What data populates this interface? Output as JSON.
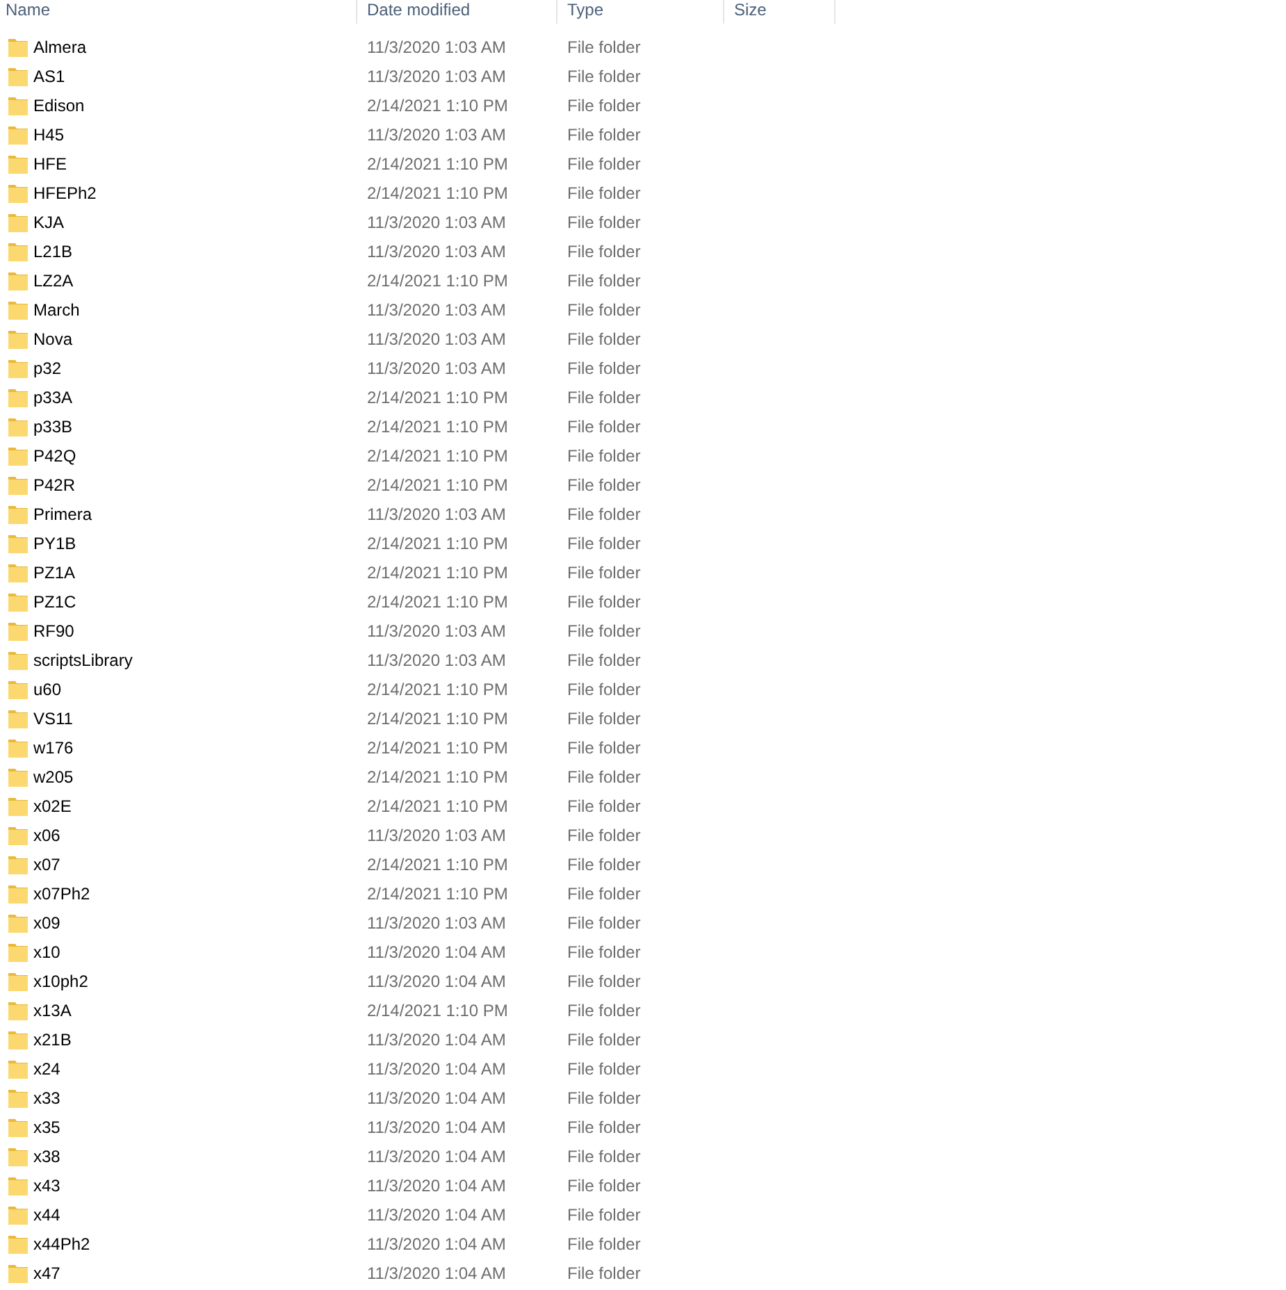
{
  "columns": [
    "Name",
    "Date modified",
    "Type",
    "Size"
  ],
  "rows": [
    {
      "name": "Almera",
      "date_modified": "11/3/2020 1:03 AM",
      "type": "File folder"
    },
    {
      "name": "AS1",
      "date_modified": "11/3/2020 1:03 AM",
      "type": "File folder"
    },
    {
      "name": "Edison",
      "date_modified": "2/14/2021 1:10 PM",
      "type": "File folder"
    },
    {
      "name": "H45",
      "date_modified": "11/3/2020 1:03 AM",
      "type": "File folder"
    },
    {
      "name": "HFE",
      "date_modified": "2/14/2021 1:10 PM",
      "type": "File folder"
    },
    {
      "name": "HFEPh2",
      "date_modified": "2/14/2021 1:10 PM",
      "type": "File folder"
    },
    {
      "name": "KJA",
      "date_modified": "11/3/2020 1:03 AM",
      "type": "File folder"
    },
    {
      "name": "L21B",
      "date_modified": "11/3/2020 1:03 AM",
      "type": "File folder"
    },
    {
      "name": "LZ2A",
      "date_modified": "2/14/2021 1:10 PM",
      "type": "File folder"
    },
    {
      "name": "March",
      "date_modified": "11/3/2020 1:03 AM",
      "type": "File folder"
    },
    {
      "name": "Nova",
      "date_modified": "11/3/2020 1:03 AM",
      "type": "File folder"
    },
    {
      "name": "p32",
      "date_modified": "11/3/2020 1:03 AM",
      "type": "File folder"
    },
    {
      "name": "p33A",
      "date_modified": "2/14/2021 1:10 PM",
      "type": "File folder"
    },
    {
      "name": "p33B",
      "date_modified": "2/14/2021 1:10 PM",
      "type": "File folder"
    },
    {
      "name": "P42Q",
      "date_modified": "2/14/2021 1:10 PM",
      "type": "File folder"
    },
    {
      "name": "P42R",
      "date_modified": "2/14/2021 1:10 PM",
      "type": "File folder"
    },
    {
      "name": "Primera",
      "date_modified": "11/3/2020 1:03 AM",
      "type": "File folder"
    },
    {
      "name": "PY1B",
      "date_modified": "2/14/2021 1:10 PM",
      "type": "File folder"
    },
    {
      "name": "PZ1A",
      "date_modified": "2/14/2021 1:10 PM",
      "type": "File folder"
    },
    {
      "name": "PZ1C",
      "date_modified": "2/14/2021 1:10 PM",
      "type": "File folder"
    },
    {
      "name": "RF90",
      "date_modified": "11/3/2020 1:03 AM",
      "type": "File folder"
    },
    {
      "name": "scriptsLibrary",
      "date_modified": "11/3/2020 1:03 AM",
      "type": "File folder"
    },
    {
      "name": "u60",
      "date_modified": "2/14/2021 1:10 PM",
      "type": "File folder"
    },
    {
      "name": "VS11",
      "date_modified": "2/14/2021 1:10 PM",
      "type": "File folder"
    },
    {
      "name": "w176",
      "date_modified": "2/14/2021 1:10 PM",
      "type": "File folder"
    },
    {
      "name": "w205",
      "date_modified": "2/14/2021 1:10 PM",
      "type": "File folder"
    },
    {
      "name": "x02E",
      "date_modified": "2/14/2021 1:10 PM",
      "type": "File folder"
    },
    {
      "name": "x06",
      "date_modified": "11/3/2020 1:03 AM",
      "type": "File folder"
    },
    {
      "name": "x07",
      "date_modified": "2/14/2021 1:10 PM",
      "type": "File folder"
    },
    {
      "name": "x07Ph2",
      "date_modified": "2/14/2021 1:10 PM",
      "type": "File folder"
    },
    {
      "name": "x09",
      "date_modified": "11/3/2020 1:03 AM",
      "type": "File folder"
    },
    {
      "name": "x10",
      "date_modified": "11/3/2020 1:04 AM",
      "type": "File folder"
    },
    {
      "name": "x10ph2",
      "date_modified": "11/3/2020 1:04 AM",
      "type": "File folder"
    },
    {
      "name": "x13A",
      "date_modified": "2/14/2021 1:10 PM",
      "type": "File folder"
    },
    {
      "name": "x21B",
      "date_modified": "11/3/2020 1:04 AM",
      "type": "File folder"
    },
    {
      "name": "x24",
      "date_modified": "11/3/2020 1:04 AM",
      "type": "File folder"
    },
    {
      "name": "x33",
      "date_modified": "11/3/2020 1:04 AM",
      "type": "File folder"
    },
    {
      "name": "x35",
      "date_modified": "11/3/2020 1:04 AM",
      "type": "File folder"
    },
    {
      "name": "x38",
      "date_modified": "11/3/2020 1:04 AM",
      "type": "File folder"
    },
    {
      "name": "x43",
      "date_modified": "11/3/2020 1:04 AM",
      "type": "File folder"
    },
    {
      "name": "x44",
      "date_modified": "11/3/2020 1:04 AM",
      "type": "File folder"
    },
    {
      "name": "x44Ph2",
      "date_modified": "11/3/2020 1:04 AM",
      "type": "File folder"
    },
    {
      "name": "x47",
      "date_modified": "11/3/2020 1:04 AM",
      "type": "File folder"
    }
  ]
}
